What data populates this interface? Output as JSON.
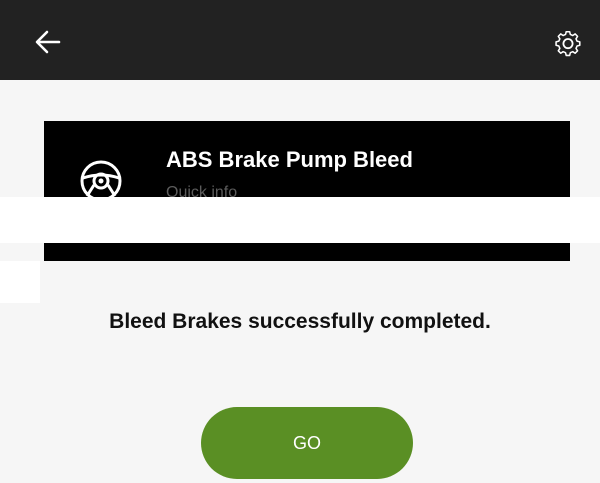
{
  "header": {
    "back_icon": "arrow-left-icon",
    "settings_icon": "gear-icon"
  },
  "card": {
    "icon": "steering-wheel-icon",
    "title": "ABS Brake Pump Bleed",
    "subtitle": "Quick info"
  },
  "status": {
    "message": "Bleed Brakes successfully completed."
  },
  "actions": {
    "go_label": "GO",
    "go_color": "#5a8f24"
  },
  "colors": {
    "topbar": "#222222",
    "card_bg": "#000000",
    "page_bg": "#f6f6f6"
  }
}
